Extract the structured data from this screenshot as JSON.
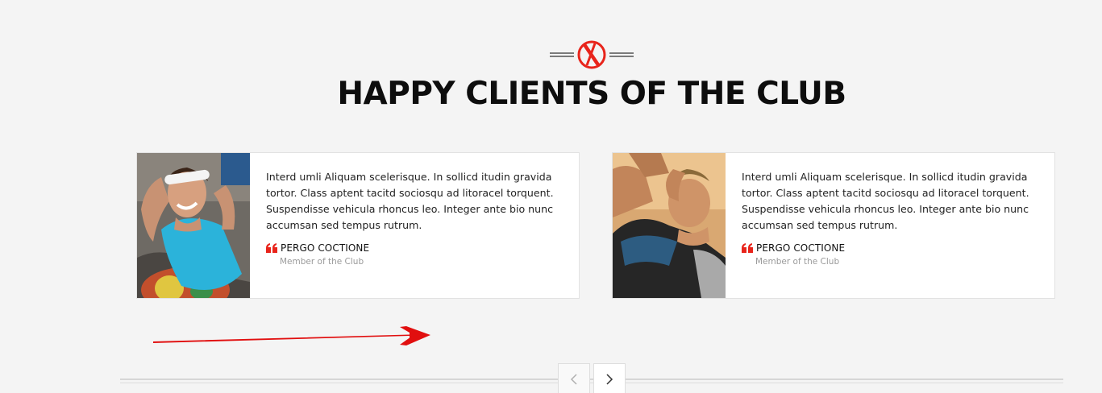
{
  "section": {
    "title": "HAPPY CLIENTS OF THE CLUB",
    "emblem_icon": "crossed-circle-emblem-icon",
    "accent_color": "#e8241b"
  },
  "testimonials": [
    {
      "text": "Interd umli Aliquam scelerisque. In sollicd itudin gravida tortor. Class aptent tacitd sociosqu ad litoracel torquent. Suspendisse vehicula rhoncus leo. Integer ante bio nunc accumsan sed tempus rutrum.",
      "author": "PERGO COCTIONE",
      "role": "Member of the Club",
      "icon": "quote-icon"
    },
    {
      "text": "Interd umli Aliquam scelerisque. In sollicd itudin gravida tortor. Class aptent tacitd sociosqu ad litoracel torquent. Suspendisse vehicula rhoncus leo. Integer ante bio nunc accumsan sed tempus rutrum.",
      "author": "PERGO COCTIONE",
      "role": "Member of the Club",
      "icon": "quote-icon"
    }
  ],
  "carousel": {
    "prev_icon": "chevron-left-icon",
    "next_icon": "chevron-right-icon"
  },
  "annotation": {
    "icon": "red-arrow-icon"
  }
}
